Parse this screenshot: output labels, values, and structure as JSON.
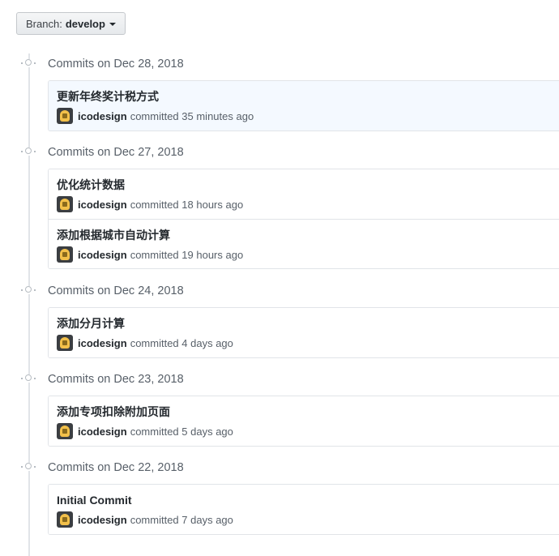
{
  "branch": {
    "label": "Branch:",
    "name": "develop"
  },
  "groups": [
    {
      "title": "Commits on Dec 28, 2018",
      "commits": [
        {
          "message": "更新年终奖计税方式",
          "author": "icodesign",
          "action": "committed",
          "time": "35 minutes ago"
        }
      ]
    },
    {
      "title": "Commits on Dec 27, 2018",
      "commits": [
        {
          "message": "优化统计数据",
          "author": "icodesign",
          "action": "committed",
          "time": "18 hours ago"
        },
        {
          "message": "添加根据城市自动计算",
          "author": "icodesign",
          "action": "committed",
          "time": "19 hours ago"
        }
      ]
    },
    {
      "title": "Commits on Dec 24, 2018",
      "commits": [
        {
          "message": "添加分月计算",
          "author": "icodesign",
          "action": "committed",
          "time": "4 days ago"
        }
      ]
    },
    {
      "title": "Commits on Dec 23, 2018",
      "commits": [
        {
          "message": "添加专项扣除附加页面",
          "author": "icodesign",
          "action": "committed",
          "time": "5 days ago"
        }
      ]
    },
    {
      "title": "Commits on Dec 22, 2018",
      "commits": [
        {
          "message": "Initial Commit",
          "author": "icodesign",
          "action": "committed",
          "time": "7 days ago"
        }
      ]
    }
  ],
  "icons": {
    "commit": "git-commit-icon",
    "avatar": "user-avatar",
    "caret": "caret-down-icon"
  }
}
